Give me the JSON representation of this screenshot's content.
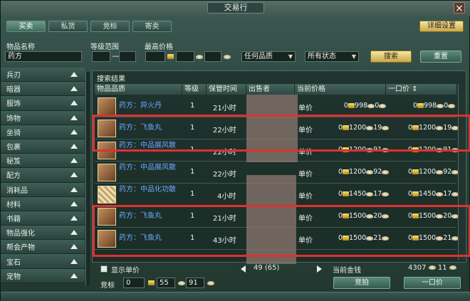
{
  "window": {
    "title": "交易行",
    "close_glyph": "×"
  },
  "tabs": [
    {
      "label": "买卖"
    },
    {
      "label": "私货"
    },
    {
      "label": "竞标"
    },
    {
      "label": "寄卖"
    }
  ],
  "detail_settings": "详细设置",
  "filters": {
    "item_name_label": "物品名称",
    "item_name_value": "药方",
    "level_range_label": "等级范围",
    "max_price_label": "最高价格",
    "quality_select": "任何品质",
    "status_select": "所有状态",
    "search_button": "搜索",
    "reset_button": "重置"
  },
  "sidebar": {
    "items": [
      {
        "label": "兵刃"
      },
      {
        "label": "暗器"
      },
      {
        "label": "服饰"
      },
      {
        "label": "饰物"
      },
      {
        "label": "坐骑"
      },
      {
        "label": "包裹"
      },
      {
        "label": "秘笈"
      },
      {
        "label": "配方"
      },
      {
        "label": "消耗品"
      },
      {
        "label": "材料"
      },
      {
        "label": "书籍"
      },
      {
        "label": "物品强化"
      },
      {
        "label": "帮会产物"
      },
      {
        "label": "宝石"
      },
      {
        "label": "宠物"
      }
    ]
  },
  "results": {
    "title": "搜索结果",
    "columns": {
      "quality": "物品品质",
      "level": "等级",
      "time": "保管时间",
      "seller": "出售者",
      "current_price": "当前价格",
      "buyout": "一口价"
    },
    "rows": [
      {
        "name": "药方：异火丹",
        "level": "1",
        "time": "21小时",
        "unit": "单价",
        "cur_a": "0",
        "cur_b": "998",
        "cur_c": "0",
        "buy_a": "0",
        "buy_b": "998",
        "buy_c": "0",
        "icon": "book"
      },
      {
        "name": "药方：飞鱼丸",
        "level": "1",
        "time": "22小时",
        "unit": "单价",
        "cur_a": "0",
        "cur_b": "1200",
        "cur_c": "19",
        "buy_a": "0",
        "buy_b": "1200",
        "buy_c": "19",
        "icon": "book"
      },
      {
        "name": "药方：中品展风散",
        "level": "1",
        "time": "22小时",
        "unit": "单价",
        "cur_a": "0",
        "cur_b": "1200",
        "cur_c": "91",
        "buy_a": "0",
        "buy_b": "1200",
        "buy_c": "91",
        "icon": "book"
      },
      {
        "name": "药方：中品展风散",
        "level": "1",
        "time": "22小时",
        "unit": "单价",
        "cur_a": "0",
        "cur_b": "1200",
        "cur_c": "92",
        "buy_a": "0",
        "buy_b": "1200",
        "buy_c": "92",
        "icon": "book"
      },
      {
        "name": "药方：中品化功散",
        "level": "1",
        "time": "4小时",
        "unit": "单价",
        "cur_a": "0",
        "cur_b": "1450",
        "cur_c": "17",
        "buy_a": "0",
        "buy_b": "1450",
        "buy_c": "17",
        "icon": "scroll"
      },
      {
        "name": "药方：飞鱼丸",
        "level": "1",
        "time": "21小时",
        "unit": "单价",
        "cur_a": "0",
        "cur_b": "1500",
        "cur_c": "20",
        "buy_a": "0",
        "buy_b": "1500",
        "buy_c": "20",
        "icon": "book"
      },
      {
        "name": "药方：飞鱼丸",
        "level": "1",
        "time": "43小时",
        "unit": "单价",
        "cur_a": "0",
        "cur_b": "1500",
        "cur_c": "21",
        "buy_a": "0",
        "buy_b": "1500",
        "buy_c": "21",
        "icon": "book"
      }
    ]
  },
  "footer": {
    "show_unit_price": "显示单价",
    "page_info": "49 (65)",
    "current_money_label": "当前金钱",
    "money_a": "4307",
    "money_b": "11",
    "bid_label": "竞标",
    "bid_a": "0",
    "bid_b": "55",
    "bid_c": "91",
    "bid_button": "竞拍",
    "buyout_button": "一口价"
  },
  "colors": {
    "accent_gold": "#c8a84a",
    "link_blue": "#6aa8ff",
    "highlight_red": "#e03030"
  }
}
